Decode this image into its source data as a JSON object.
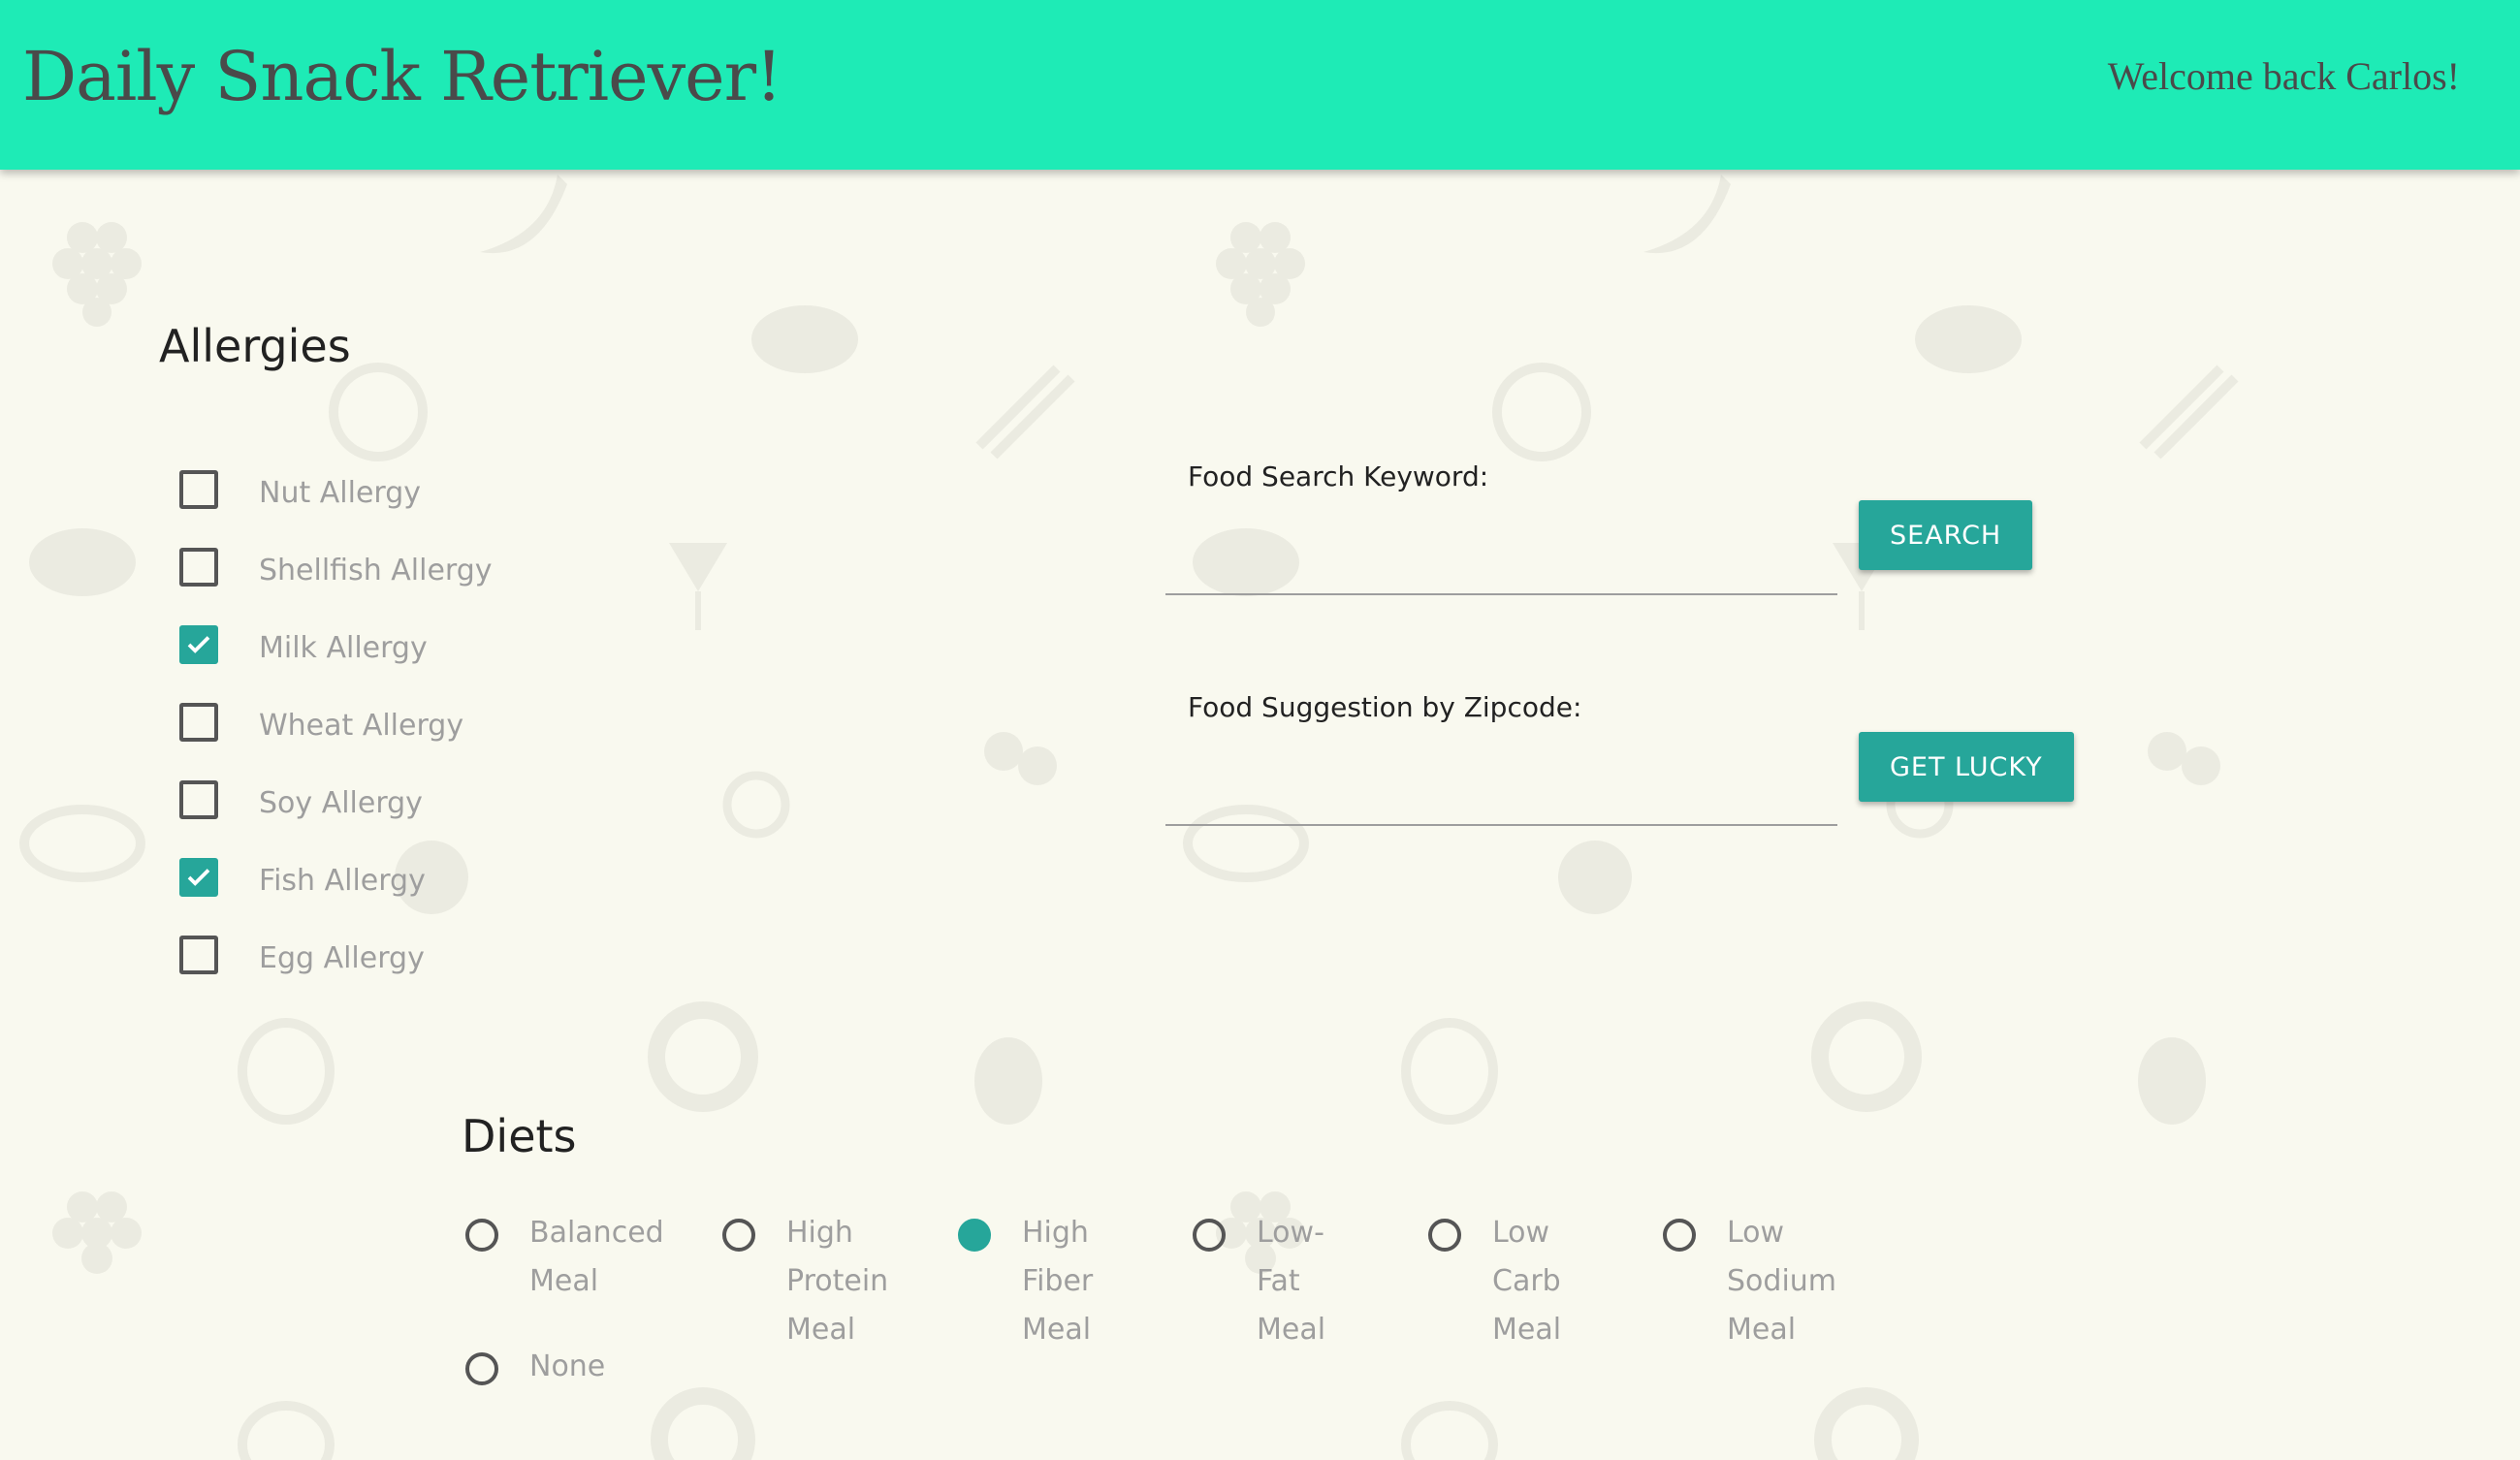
{
  "header": {
    "title": "Daily Snack Retriever!",
    "welcome": "Welcome back Carlos!"
  },
  "allergies": {
    "title": "Allergies",
    "items": [
      {
        "label": "Nut Allergy",
        "checked": false
      },
      {
        "label": "Shellfish Allergy",
        "checked": false
      },
      {
        "label": "Milk Allergy",
        "checked": true
      },
      {
        "label": "Wheat Allergy",
        "checked": false
      },
      {
        "label": "Soy Allergy",
        "checked": false
      },
      {
        "label": "Fish Allergy",
        "checked": true
      },
      {
        "label": "Egg Allergy",
        "checked": false
      }
    ]
  },
  "search": {
    "keyword_label": "Food Search Keyword:",
    "keyword_value": "",
    "search_button": "SEARCH",
    "zipcode_label": "Food Suggestion by Zipcode:",
    "zipcode_value": "",
    "lucky_button": "GET LUCKY"
  },
  "diets": {
    "title": "Diets",
    "options": [
      {
        "label_lines": [
          "Balanced",
          "Meal"
        ],
        "selected": false
      },
      {
        "label_lines": [
          "High",
          "Protein",
          "Meal"
        ],
        "selected": false
      },
      {
        "label_lines": [
          "High",
          "Fiber",
          "Meal"
        ],
        "selected": true
      },
      {
        "label_lines": [
          "Low-Fat",
          "Meal"
        ],
        "selected": false
      },
      {
        "label_lines": [
          "Low Carb",
          "Meal"
        ],
        "selected": false
      },
      {
        "label_lines": [
          "Low",
          "Sodium",
          "Meal"
        ],
        "selected": false
      },
      {
        "label_lines": [
          "None"
        ],
        "selected": false
      }
    ]
  },
  "colors": {
    "header_bg": "#1eebb6",
    "accent": "#26a69a",
    "page_bg": "#f9f9ef"
  }
}
